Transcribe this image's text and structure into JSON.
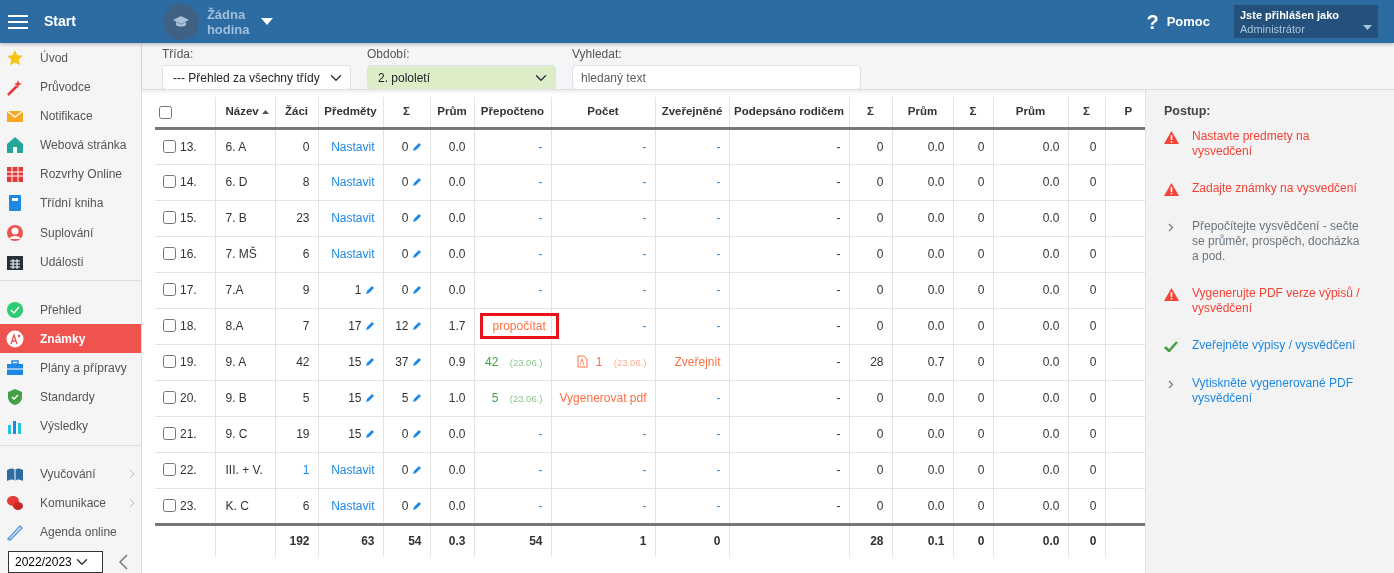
{
  "header": {
    "title": "Start",
    "lesson": "Žádna hodina",
    "help_icon": "?",
    "help": "Pomoc",
    "user_label": "Jste přihlášen jako",
    "user_role": "Administrátor"
  },
  "sidebar": {
    "items": [
      {
        "label": "Úvod",
        "selected": false,
        "expandable": false,
        "divider_after": false
      },
      {
        "label": "Průvodce",
        "selected": false,
        "expandable": false,
        "divider_after": false
      },
      {
        "label": "Notifikace",
        "selected": false,
        "expandable": false,
        "divider_after": false
      },
      {
        "label": "Webová stránka",
        "selected": false,
        "expandable": false,
        "divider_after": false
      },
      {
        "label": "Rozvrhy Online",
        "selected": false,
        "expandable": false,
        "divider_after": false
      },
      {
        "label": "Třídní kniha",
        "selected": false,
        "expandable": false,
        "divider_after": false
      },
      {
        "label": "Suplování",
        "selected": false,
        "expandable": false,
        "divider_after": false
      },
      {
        "label": "Události",
        "selected": false,
        "expandable": false,
        "divider_after": true
      },
      {
        "label": "Přehled",
        "selected": false,
        "expandable": false,
        "divider_after": false
      },
      {
        "label": "Známky",
        "selected": true,
        "expandable": false,
        "divider_after": false
      },
      {
        "label": "Plány a přípravy",
        "selected": false,
        "expandable": false,
        "divider_after": false
      },
      {
        "label": "Standardy",
        "selected": false,
        "expandable": false,
        "divider_after": false
      },
      {
        "label": "Výsledky",
        "selected": false,
        "expandable": false,
        "divider_after": true
      },
      {
        "label": "Vyučování",
        "selected": false,
        "expandable": true,
        "divider_after": false
      },
      {
        "label": "Komunikace",
        "selected": false,
        "expandable": true,
        "divider_after": false
      },
      {
        "label": "Agenda online",
        "selected": false,
        "expandable": false,
        "divider_after": false
      }
    ],
    "year": "2022/2023"
  },
  "filters": {
    "class_label": "Třída:",
    "class_value": "--- Přehled za všechny třídy",
    "period_label": "Období:",
    "period_value": "2. pololetí",
    "search_label": "Vyhledat:",
    "search_placeholder": "hledaný text"
  },
  "table": {
    "columns": [
      {
        "kind": "checkbox",
        "checked": false
      },
      {
        "label": "Název",
        "kind": "sort"
      },
      {
        "label": "Žáci",
        "kind": "text"
      },
      {
        "label": "Předměty",
        "kind": "text"
      },
      {
        "label": "Σ",
        "kind": "text"
      },
      {
        "label": "Prům",
        "kind": "text"
      },
      {
        "label": "Přepočteno",
        "kind": "text"
      },
      {
        "label": "Počet",
        "kind": "text"
      },
      {
        "label": "Zveřejněné",
        "kind": "text"
      },
      {
        "label": "Podepsáno rodičem",
        "kind": "text"
      },
      {
        "label": "Σ",
        "kind": "text"
      },
      {
        "label": "Prům",
        "kind": "text"
      },
      {
        "label": "Σ",
        "kind": "text"
      },
      {
        "label": "Prům",
        "kind": "text"
      },
      {
        "label": "Σ",
        "kind": "text"
      },
      {
        "label": "P",
        "kind": "text"
      }
    ],
    "rows": [
      {
        "checked": false,
        "no": "13.",
        "name": "6. A",
        "students": "0",
        "students_link": false,
        "subjects": {
          "kind": "link",
          "text": "Nastavit"
        },
        "sum": "0",
        "avg": "0.0",
        "recalc": {
          "kind": "dash",
          "text": "-"
        },
        "count": {
          "kind": "dash",
          "text": "-"
        },
        "published": {
          "kind": "dash",
          "text": "-"
        },
        "signed": "-",
        "extra": [
          "0",
          "0.0",
          "0",
          "0.0",
          "0"
        ]
      },
      {
        "checked": false,
        "no": "14.",
        "name": "6. D",
        "students": "8",
        "students_link": false,
        "subjects": {
          "kind": "link",
          "text": "Nastavit"
        },
        "sum": "0",
        "avg": "0.0",
        "recalc": {
          "kind": "dash",
          "text": "-"
        },
        "count": {
          "kind": "dash",
          "text": "-"
        },
        "published": {
          "kind": "dash",
          "text": "-"
        },
        "signed": "-",
        "extra": [
          "0",
          "0.0",
          "0",
          "0.0",
          "0"
        ]
      },
      {
        "checked": false,
        "no": "15.",
        "name": "7. B",
        "students": "23",
        "students_link": false,
        "subjects": {
          "kind": "link",
          "text": "Nastavit"
        },
        "sum": "0",
        "avg": "0.0",
        "recalc": {
          "kind": "dash",
          "text": "-"
        },
        "count": {
          "kind": "dash",
          "text": "-"
        },
        "published": {
          "kind": "dash",
          "text": "-"
        },
        "signed": "-",
        "extra": [
          "0",
          "0.0",
          "0",
          "0.0",
          "0"
        ]
      },
      {
        "checked": false,
        "no": "16.",
        "name": "7. MŠ",
        "students": "6",
        "students_link": false,
        "subjects": {
          "kind": "link",
          "text": "Nastavit"
        },
        "sum": "0",
        "avg": "0.0",
        "recalc": {
          "kind": "dash",
          "text": "-"
        },
        "count": {
          "kind": "dash",
          "text": "-"
        },
        "published": {
          "kind": "dash",
          "text": "-"
        },
        "signed": "-",
        "extra": [
          "0",
          "0.0",
          "0",
          "0.0",
          "0"
        ]
      },
      {
        "checked": false,
        "no": "17.",
        "name": "7.A",
        "students": "9",
        "students_link": false,
        "subjects": {
          "kind": "value",
          "text": "1"
        },
        "sum": "0",
        "avg": "0.0",
        "recalc": {
          "kind": "dash",
          "text": "-"
        },
        "count": {
          "kind": "dash",
          "text": "-"
        },
        "published": {
          "kind": "dash",
          "text": "-"
        },
        "signed": "-",
        "extra": [
          "0",
          "0.0",
          "0",
          "0.0",
          "0"
        ]
      },
      {
        "checked": false,
        "no": "18.",
        "name": "8.A",
        "students": "7",
        "students_link": false,
        "subjects": {
          "kind": "value",
          "text": "17"
        },
        "sum": "12",
        "avg": "1.7",
        "recalc": {
          "kind": "action",
          "text": "propočítat",
          "highlighted": true
        },
        "count": {
          "kind": "dash",
          "text": "-"
        },
        "published": {
          "kind": "dash",
          "text": "-"
        },
        "signed": "-",
        "extra": [
          "0",
          "0.0",
          "0",
          "0.0",
          "0"
        ]
      },
      {
        "checked": false,
        "no": "19.",
        "name": "9. A",
        "students": "42",
        "students_link": false,
        "subjects": {
          "kind": "value",
          "text": "15"
        },
        "sum": "37",
        "avg": "0.9",
        "recalc": {
          "kind": "value",
          "text": "42",
          "date": "(23.06.)"
        },
        "count": {
          "kind": "pdf",
          "text": "1",
          "date": "(23.06.)"
        },
        "published": {
          "kind": "action",
          "text": "Zveřejnit"
        },
        "signed": "-",
        "extra": [
          "28",
          "0.7",
          "0",
          "0.0",
          "0"
        ]
      },
      {
        "checked": false,
        "no": "20.",
        "name": "9. B",
        "students": "5",
        "students_link": false,
        "subjects": {
          "kind": "value",
          "text": "15"
        },
        "sum": "5",
        "avg": "1.0",
        "recalc": {
          "kind": "value",
          "text": "5",
          "date": "(23.06.)"
        },
        "count": {
          "kind": "action",
          "text": "Vygenerovat pdf"
        },
        "published": {
          "kind": "dash",
          "text": "-"
        },
        "signed": "-",
        "extra": [
          "0",
          "0.0",
          "0",
          "0.0",
          "0"
        ]
      },
      {
        "checked": false,
        "no": "21.",
        "name": "9. C",
        "students": "19",
        "students_link": false,
        "subjects": {
          "kind": "value",
          "text": "15"
        },
        "sum": "0",
        "avg": "0.0",
        "recalc": {
          "kind": "dash",
          "text": "-"
        },
        "count": {
          "kind": "dash",
          "text": "-"
        },
        "published": {
          "kind": "dash",
          "text": "-"
        },
        "signed": "-",
        "extra": [
          "0",
          "0.0",
          "0",
          "0.0",
          "0"
        ]
      },
      {
        "checked": false,
        "no": "22.",
        "name": "III. + V.",
        "students": "1",
        "students_link": true,
        "subjects": {
          "kind": "link",
          "text": "Nastavit"
        },
        "sum": "0",
        "avg": "0.0",
        "recalc": {
          "kind": "dash",
          "text": "-"
        },
        "count": {
          "kind": "dash",
          "text": "-"
        },
        "published": {
          "kind": "dash",
          "text": "-"
        },
        "signed": "-",
        "extra": [
          "0",
          "0.0",
          "0",
          "0.0",
          "0"
        ]
      },
      {
        "checked": false,
        "no": "23.",
        "name": "K. C",
        "students": "6",
        "students_link": false,
        "subjects": {
          "kind": "link",
          "text": "Nastavit"
        },
        "sum": "0",
        "avg": "0.0",
        "recalc": {
          "kind": "dash",
          "text": "-"
        },
        "count": {
          "kind": "dash",
          "text": "-"
        },
        "published": {
          "kind": "dash",
          "text": "-"
        },
        "signed": "-",
        "extra": [
          "0",
          "0.0",
          "0",
          "0.0",
          "0"
        ]
      }
    ],
    "totals": {
      "students": "192",
      "subjects": "63",
      "sum": "54",
      "avg": "0.3",
      "recalc": "54",
      "count": "1",
      "published": "0",
      "extra": [
        "28",
        "0.1",
        "0",
        "0.0",
        "0"
      ]
    }
  },
  "steps": {
    "title": "Postup:",
    "items": [
      {
        "kind": "warning",
        "text": "Nastavte predmety na vysvedčení",
        "disabled": false
      },
      {
        "kind": "warning",
        "text": "Zadajte známky na vysvedčení",
        "disabled": false
      },
      {
        "kind": "next",
        "text": "Přepočítejte vysvědčení - sečte se průměr, prospěch, docházka a pod.",
        "disabled": true
      },
      {
        "kind": "warning",
        "text": "Vygenerujte PDF verze výpisů / vysvědčení",
        "disabled": false
      },
      {
        "kind": "done",
        "text": "Zveřejněte výpisy / vysvědčení",
        "disabled": false
      },
      {
        "kind": "next",
        "text": "Vytiskněte vygenerované PDF vysvědčení",
        "disabled": false
      }
    ]
  }
}
